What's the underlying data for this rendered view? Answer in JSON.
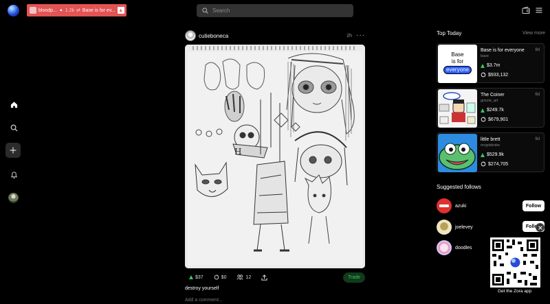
{
  "colors": {
    "background": "#000000",
    "ticker_bg": "#e35353",
    "accent_green": "#35c759",
    "search_bg": "#333333"
  },
  "ticker": {
    "name": "bloodp...",
    "count": "1.2k",
    "title": "Base is for ev..."
  },
  "search": {
    "placeholder": "Search"
  },
  "header_icons": [
    "wallet-icon",
    "menu-icon"
  ],
  "left_nav": [
    "home-icon",
    "search-icon",
    "create-icon",
    "notifications-icon",
    "profile-avatar"
  ],
  "post": {
    "username": "cutieboneca",
    "time": "2h",
    "market_cap": "$37",
    "volume": "$0",
    "holders": "12",
    "trade_label": "Trade",
    "caption": "destroy yourself",
    "comment_placeholder": "Add a comment..."
  },
  "top_today": {
    "title": "Top Today",
    "view_more": "View more",
    "items": [
      {
        "name": "Base is for everyone",
        "handle": "base",
        "age": "8d",
        "market_cap": "$3.7m",
        "volume": "$933,132"
      },
      {
        "name": "The Coiner",
        "handle": "grizzle_art",
        "age": "6d",
        "market_cap": "$249.7k",
        "volume": "$679,901"
      },
      {
        "name": "little brett",
        "handle": "nrrgoldrobe",
        "age": "9d",
        "market_cap": "$529.9k",
        "volume": "$274,705"
      }
    ],
    "base_logo_text": [
      "Base",
      "is for",
      "everyone"
    ]
  },
  "suggested": {
    "title": "Suggested follows",
    "follow_label": "Follow",
    "items": [
      {
        "name": "azuki"
      },
      {
        "name": "joelevey"
      },
      {
        "name": "doodles"
      }
    ]
  },
  "qr": {
    "label": "Get the Zora app"
  }
}
